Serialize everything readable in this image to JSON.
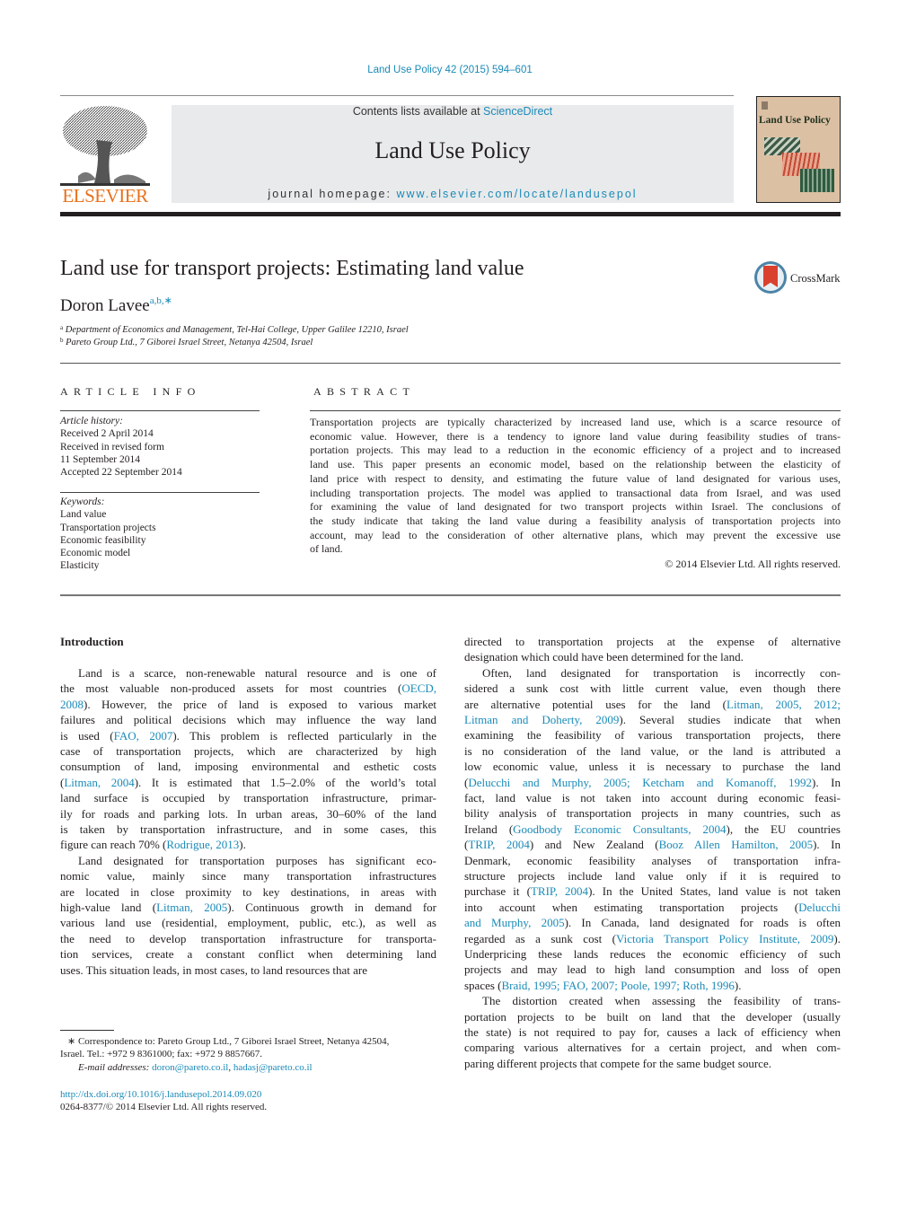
{
  "header": {
    "citation": "Land Use Policy 42 (2015) 594–601",
    "contents_prefix": "Contents lists available at ",
    "contents_link": "ScienceDirect",
    "journal_name": "Land Use Policy",
    "homepage_prefix": "journal homepage: ",
    "homepage_link": "www.elsevier.com/locate/landusepol",
    "publisher_logo_text": "ELSEVIER",
    "cover_title": "Land Use Policy",
    "crossmark_label": "CrossMark"
  },
  "article": {
    "title": "Land use for transport projects: Estimating land value",
    "author": "Doron Lavee",
    "author_marks": "a,b,",
    "author_star": "∗",
    "affiliations": [
      {
        "mark": "a",
        "text": "Department of Economics and Management, Tel-Hai College, Upper Galilee 12210, Israel"
      },
      {
        "mark": "b",
        "text": "Pareto Group Ltd., 7 Giborei Israel Street, Netanya 42504, Israel"
      }
    ]
  },
  "article_info": {
    "heading": "ARTICLE INFO",
    "history_label": "Article history:",
    "history": [
      "Received 2 April 2014",
      "Received in revised form",
      "11 September 2014",
      "Accepted 22 September 2014"
    ],
    "keywords_label": "Keywords:",
    "keywords": [
      "Land value",
      "Transportation projects",
      "Economic feasibility",
      "Economic model",
      "Elasticity"
    ]
  },
  "abstract": {
    "heading": "ABSTRACT",
    "lines": [
      "Transportation projects are typically characterized by increased land use, which is a scarce resource of",
      "economic value. However, there is a tendency to ignore land value during feasibility studies of trans-",
      "portation projects. This may lead to a reduction in the economic efficiency of a project and to increased",
      "land use. This paper presents an economic model, based on the relationship between the elasticity of",
      "land price with respect to density, and estimating the future value of land designated for various uses,",
      "including transportation projects. The model was applied to transactional data from Israel, and was used",
      "for examining the value of land designated for two transport projects within Israel. The conclusions of",
      "the study indicate that taking the land value during a feasibility analysis of transportation projects into",
      "account, may lead to the consideration of other alternative plans, which may prevent the excessive use",
      "of land."
    ],
    "copyright": "© 2014 Elsevier Ltd. All rights reserved."
  },
  "body": {
    "section_heading": "Introduction",
    "left_lines": [
      [
        {
          "t": "Land is a scarce, non-renewable natural resource and is one of"
        }
      ],
      [
        {
          "t": "the most valuable non-produced assets for most countries ("
        },
        {
          "t": "OECD,",
          "link": true
        }
      ],
      [
        {
          "t": "2008",
          "link": true
        },
        {
          "t": "). However, the price of land is exposed to various market"
        }
      ],
      [
        {
          "t": "failures and political decisions which may influence the way land"
        }
      ],
      [
        {
          "t": "is used ("
        },
        {
          "t": "FAO, 2007",
          "link": true
        },
        {
          "t": "). This problem is reflected particularly in the"
        }
      ],
      [
        {
          "t": "case of transportation projects, which are characterized by high"
        }
      ],
      [
        {
          "t": "consumption of land, imposing environmental and esthetic costs"
        }
      ],
      [
        {
          "t": "("
        },
        {
          "t": "Litman, 2004",
          "link": true
        },
        {
          "t": "). It is estimated that 1.5–2.0% of the world’s total"
        }
      ],
      [
        {
          "t": "land surface is occupied by transportation infrastructure, primar-"
        }
      ],
      [
        {
          "t": "ily for roads and parking lots. In urban areas, 30–60% of the land"
        }
      ],
      [
        {
          "t": "is taken by transportation infrastructure, and in some cases, this"
        }
      ],
      [
        {
          "t": "figure can reach 70% ("
        },
        {
          "t": "Rodrigue, 2013",
          "link": true
        },
        {
          "t": ")."
        }
      ],
      [
        {
          "t": "Land designated for transportation purposes has significant eco-"
        }
      ],
      [
        {
          "t": "nomic value, mainly since many transportation infrastructures"
        }
      ],
      [
        {
          "t": "are located in close proximity to key destinations, in areas with"
        }
      ],
      [
        {
          "t": "high-value land ("
        },
        {
          "t": "Litman, 2005",
          "link": true
        },
        {
          "t": "). Continuous growth in demand for"
        }
      ],
      [
        {
          "t": "various land use (residential, employment, public, etc.), as well as"
        }
      ],
      [
        {
          "t": "the need to develop transportation infrastructure for transporta-"
        }
      ],
      [
        {
          "t": "tion services, create a constant conflict when determining land"
        }
      ],
      [
        {
          "t": "uses. This situation leads, in most cases, to land resources that are"
        }
      ]
    ],
    "right_lines": [
      [
        {
          "t": "directed to transportation projects at the expense of alternative"
        }
      ],
      [
        {
          "t": "designation which could have been determined for the land."
        }
      ],
      [
        {
          "t": "Often, land designated for transportation is incorrectly con-"
        }
      ],
      [
        {
          "t": "sidered a sunk cost with little current value, even though there"
        }
      ],
      [
        {
          "t": "are alternative potential uses for the land ("
        },
        {
          "t": "Litman, 2005, 2012;",
          "link": true
        }
      ],
      [
        {
          "t": "Litman and Doherty, 2009",
          "link": true
        },
        {
          "t": "). Several studies indicate that when"
        }
      ],
      [
        {
          "t": "examining the feasibility of various transportation projects, there"
        }
      ],
      [
        {
          "t": "is no consideration of the land value, or the land is attributed a"
        }
      ],
      [
        {
          "t": "low economic value, unless it is necessary to purchase the land"
        }
      ],
      [
        {
          "t": "("
        },
        {
          "t": "Delucchi and Murphy, 2005; Ketcham and Komanoff, 1992",
          "link": true
        },
        {
          "t": "). In"
        }
      ],
      [
        {
          "t": "fact, land value is not taken into account during economic feasi-"
        }
      ],
      [
        {
          "t": "bility analysis of transportation projects in many countries, such as"
        }
      ],
      [
        {
          "t": "Ireland ("
        },
        {
          "t": "Goodbody Economic Consultants, 2004",
          "link": true
        },
        {
          "t": "), the EU countries"
        }
      ],
      [
        {
          "t": "("
        },
        {
          "t": "TRIP, 2004",
          "link": true
        },
        {
          "t": ") and New Zealand ("
        },
        {
          "t": "Booz Allen Hamilton, 2005",
          "link": true
        },
        {
          "t": "). In"
        }
      ],
      [
        {
          "t": "Denmark, economic feasibility analyses of transportation infra-"
        }
      ],
      [
        {
          "t": "structure projects include land value only if it is required to"
        }
      ],
      [
        {
          "t": "purchase it ("
        },
        {
          "t": "TRIP, 2004",
          "link": true
        },
        {
          "t": "). In the United States, land value is not taken"
        }
      ],
      [
        {
          "t": "into account when estimating transportation projects ("
        },
        {
          "t": "Delucchi",
          "link": true
        }
      ],
      [
        {
          "t": "and Murphy, 2005",
          "link": true
        },
        {
          "t": "). In Canada, land designated for roads is often"
        }
      ],
      [
        {
          "t": "regarded as a sunk cost ("
        },
        {
          "t": "Victoria Transport Policy Institute, 2009",
          "link": true
        },
        {
          "t": ")."
        }
      ],
      [
        {
          "t": "Underpricing these lands reduces the economic efficiency of such"
        }
      ],
      [
        {
          "t": "projects and may lead to high land consumption and loss of open"
        }
      ],
      [
        {
          "t": "spaces ("
        },
        {
          "t": "Braid, 1995; FAO, 2007; Poole, 1997; Roth, 1996",
          "link": true
        },
        {
          "t": ")."
        }
      ],
      [
        {
          "t": "The distortion created when assessing the feasibility of trans-"
        }
      ],
      [
        {
          "t": "portation projects to be built on land that the developer (usually"
        }
      ],
      [
        {
          "t": "the state) is not required to pay for, causes a lack of efficiency when"
        }
      ],
      [
        {
          "t": "comparing various alternatives for a certain project, and when com-"
        }
      ],
      [
        {
          "t": "paring different projects that compete for the same budget source."
        }
      ]
    ]
  },
  "footnote": {
    "correspondence_line1": "∗ Correspondence to: Pareto Group Ltd., 7 Giborei Israel Street, Netanya 42504,",
    "correspondence_line2": "Israel. Tel.: +972 9 8361000; fax: +972 9 8857667.",
    "email_label": "E-mail addresses: ",
    "emails": [
      "doron@pareto.co.il",
      "hadasj@pareto.co.il"
    ],
    "doi": "http://dx.doi.org/10.1016/j.landusepol.2014.09.020",
    "issn_line": "0264-8377/© 2014 Elsevier Ltd. All rights reserved."
  },
  "colors": {
    "link": "#1a8ab8",
    "elsevier_orange": "#e9711c",
    "banner_gray": "#e9eaeb",
    "cover_tan": "#dcc0a3"
  }
}
